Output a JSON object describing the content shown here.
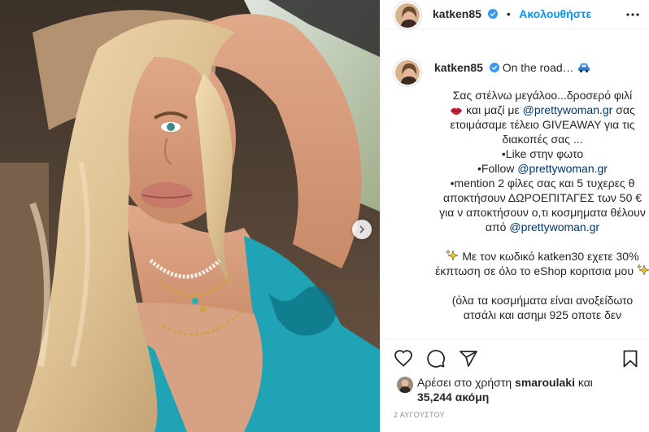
{
  "post": {
    "username": "katken85",
    "follow_label": "Ακολουθήστε",
    "dot": "•",
    "caption_first": "On the road…",
    "caption_lines": [
      "Σας στέλνω μεγάλοο...δροσερό φιλί",
      "και μαζί με",
      "σας ετοιμάσαμε τέλειο GIVEAWAY για τις διακοπές σας ...",
      "•Like στην φωτο",
      "•Follow",
      "•mention 2 φίλες σας και 5 τυχερες θ αποκτήσουν ΔΩΡΟΕΠΙΤΑΓΕΣ των 50 € για ν αποκτήσουν ο,τι κοσμηματα θέλουν από",
      "Με τον κωδικό katken30 εχετε 30% έκπτωση σε όλο το eShop κοριτσια μου",
      "(όλα τα κοσμήματα είναι ανοξείδωτο ατσάλι και ασημι 925 οποτε δεν"
    ],
    "mention": "@prettywoman.gr",
    "likes_prefix": "Αρέσει στο χρήστη",
    "likes_user": "smaroulaki",
    "likes_and": "και",
    "likes_count": "35,244 ακόμη",
    "date": "2 ΑΥΓΟΥΣΤΟΥ"
  },
  "icons": {
    "verified": "verified-badge-icon",
    "more": "more-options-icon",
    "car": "car-emoji-icon",
    "lips": "lips-emoji-icon",
    "sparkles": "sparkles-emoji-icon",
    "heart": "heart-icon",
    "comment": "comment-icon",
    "share": "share-icon",
    "save": "bookmark-icon",
    "next": "chevron-right-icon"
  },
  "colors": {
    "accent": "#0095f6",
    "mention": "#00376b",
    "verified": "#3897f0",
    "muted": "#8e8e8e"
  }
}
